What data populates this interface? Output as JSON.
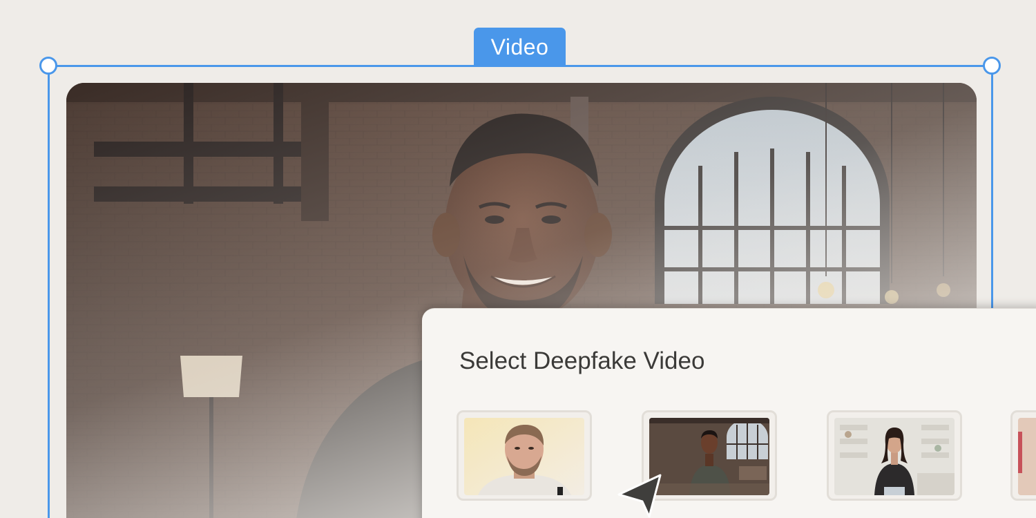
{
  "selection": {
    "label": "Video",
    "accent_color": "#4a97ea"
  },
  "dialog": {
    "title": "Select Deepfake Video",
    "thumbnails": [
      {
        "name": "man-bright-room",
        "alt": ""
      },
      {
        "name": "man-brick-loft",
        "alt": ""
      },
      {
        "name": "woman-white-shelves",
        "alt": ""
      },
      {
        "name": "partial-thumbnail",
        "alt": ""
      }
    ]
  },
  "icons": {
    "cursor": "arrow-cursor-icon"
  }
}
